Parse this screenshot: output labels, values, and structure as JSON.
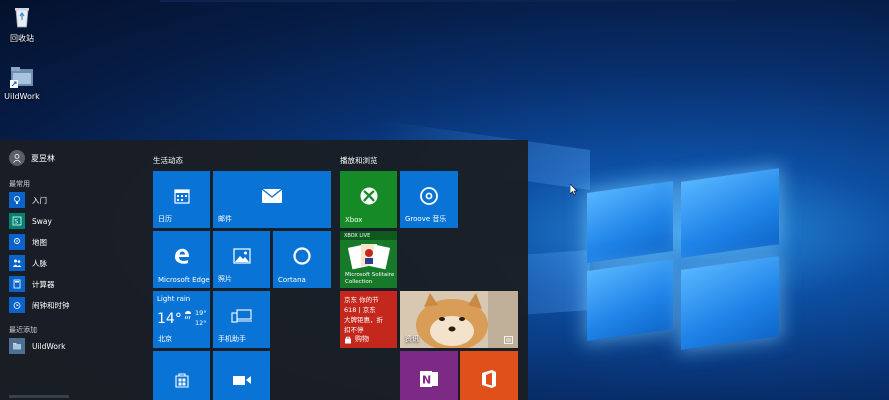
{
  "desktop": {
    "icons": [
      {
        "label": "回收站",
        "icon": "recycle-bin-icon"
      },
      {
        "label": "UildWork",
        "icon": "folder-shortcut-icon"
      }
    ]
  },
  "start_menu": {
    "user": {
      "name": "夏昱林"
    },
    "most_used_heading": "最常用",
    "most_used": [
      {
        "label": "入门",
        "icon": "lightbulb-icon"
      },
      {
        "label": "Sway",
        "icon": "sway-icon"
      },
      {
        "label": "地图",
        "icon": "map-pin-icon"
      },
      {
        "label": "人脉",
        "icon": "people-icon"
      },
      {
        "label": "计算器",
        "icon": "calculator-icon"
      },
      {
        "label": "闹钟和时钟",
        "icon": "alarm-clock-icon"
      }
    ],
    "recent_heading": "最近添加",
    "recent": [
      {
        "label": "UildWork",
        "icon": "folder-icon"
      }
    ],
    "groups": {
      "life": "生活动态",
      "play": "播放和浏览"
    },
    "tiles": {
      "calendar": "日历",
      "mail": "邮件",
      "edge": "Microsoft Edge",
      "photos": "照片",
      "cortana": "Cortana",
      "weather_cond": "Light rain",
      "weather_temp": "14°",
      "weather_hi": "19°",
      "weather_lo": "12°",
      "weather_city": "北京",
      "phone": "手机助手",
      "xbox": "Xbox",
      "groove": "Groove 音乐",
      "solitaire_brand": "XBOX LIVE",
      "solitaire": "Microsoft Solitaire Collection",
      "store_promo_1": "京东 你的节",
      "store_promo_2": "618 | 京东",
      "store_promo_3": "大牌钜惠，折",
      "store_promo_4": "扣不停",
      "store": "购物",
      "news": "资讯",
      "onenote": "",
      "office": ""
    }
  }
}
